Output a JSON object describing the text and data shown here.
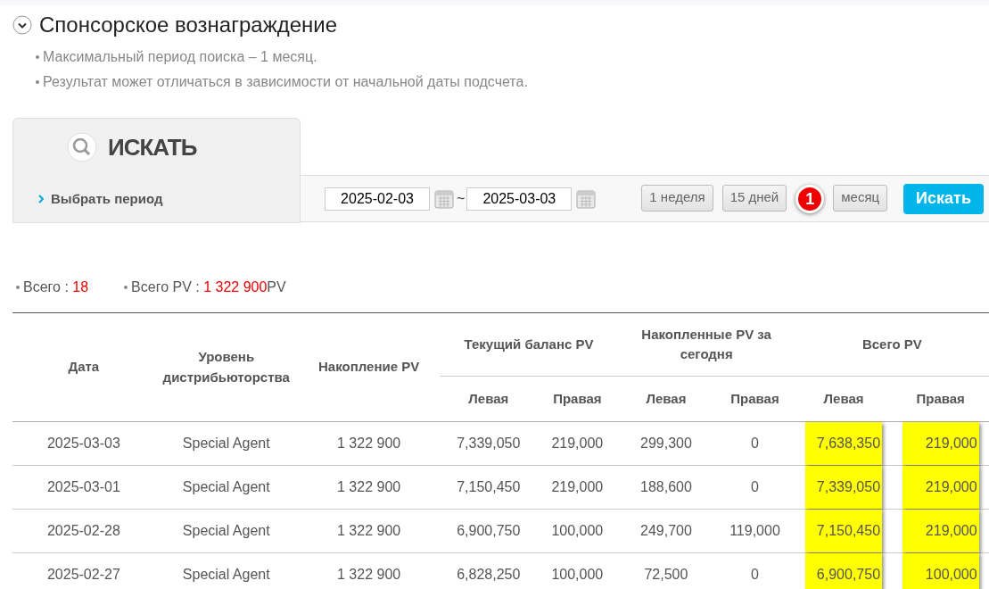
{
  "title": "Спонсорское вознаграждение",
  "notes": [
    "Максимальный период поиска – 1 месяц.",
    "Результат может отличаться в зависимости от начальной даты подсчета."
  ],
  "search": {
    "tab_label": "ИСКАТЬ",
    "period_label": "Выбрать период",
    "date_from": "2025-02-03",
    "separator": "~",
    "date_to": "2025-03-03",
    "presets": [
      {
        "label": "1 неделя"
      },
      {
        "label": "15 дней"
      },
      {
        "label": "месяц",
        "callout": "1"
      }
    ],
    "submit": "Искать"
  },
  "summary": [
    {
      "label": "Всего : ",
      "value": "18"
    },
    {
      "label": "Всего PV : ",
      "value": "1 322 900",
      "unit": "PV"
    }
  ],
  "table": {
    "groups": [
      {
        "label": "Дата"
      },
      {
        "label": "Уровень дистрибьюторства"
      },
      {
        "label": "Накопление PV"
      },
      {
        "label": "Текущий баланс PV",
        "subcolumns": [
          {
            "label": "Левая",
            "highlighted": false
          },
          {
            "label": "Правая",
            "highlighted": false
          }
        ]
      },
      {
        "label": "Накопленные PV за сегодня",
        "subcolumns": [
          {
            "label": "Левая",
            "highlighted": false
          },
          {
            "label": "Правая",
            "highlighted": false
          }
        ]
      },
      {
        "label": "Всего PV",
        "subcolumns": [
          {
            "label": "Левая",
            "highlighted": true
          },
          {
            "label": "Правая",
            "highlighted": true
          }
        ]
      }
    ],
    "rows": [
      [
        "2025-03-03",
        "Special Agent",
        "1 322 900",
        "7,339,050",
        "219,000",
        "299,300",
        "0",
        "7,638,350",
        "219,000"
      ],
      [
        "2025-03-01",
        "Special Agent",
        "1 322 900",
        "7,150,450",
        "219,000",
        "188,600",
        "0",
        "7,339,050",
        "219,000"
      ],
      [
        "2025-02-28",
        "Special Agent",
        "1 322 900",
        "6,900,750",
        "100,000",
        "249,700",
        "119,000",
        "7,150,450",
        "219,000"
      ],
      [
        "2025-02-27",
        "Special Agent",
        "1 322 900",
        "6,828,250",
        "100,000",
        "72,500",
        "0",
        "6,900,750",
        "100,000"
      ]
    ]
  }
}
